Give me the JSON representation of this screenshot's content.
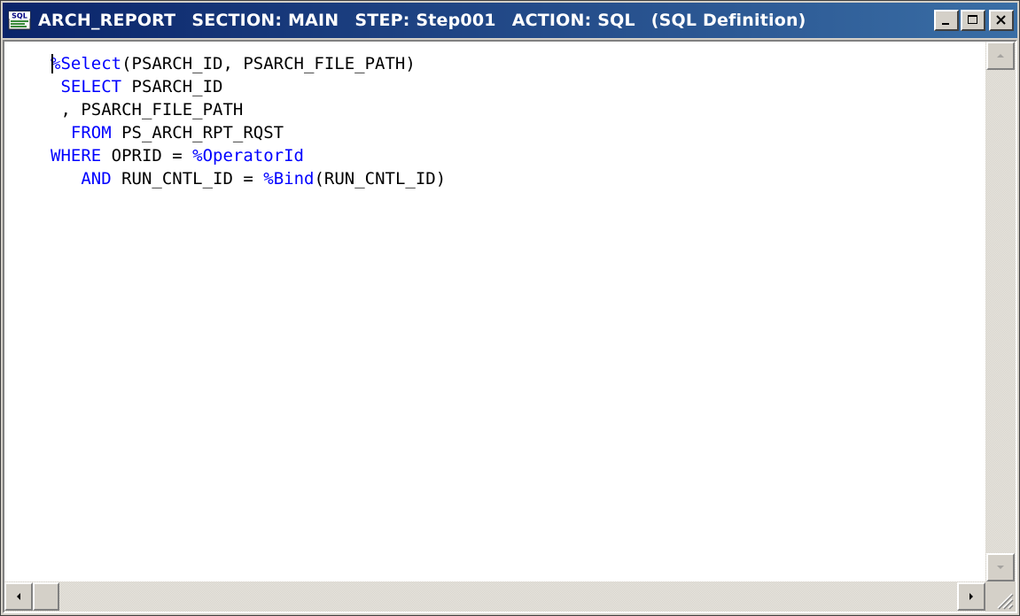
{
  "window": {
    "title_parts": [
      "ARCH_REPORT",
      "SECTION: MAIN",
      "STEP: Step001",
      "ACTION: SQL",
      "(SQL Definition)"
    ],
    "app_icon_label": "SQL",
    "buttons": {
      "minimize": "minimize-icon",
      "maximize": "maximize-icon",
      "close": "close-icon"
    }
  },
  "editor": {
    "lines": [
      {
        "indent": "",
        "tokens": [
          {
            "t": "%Select",
            "kw": true
          },
          {
            "t": "(PSARCH_ID, PSARCH_FILE_PATH)",
            "kw": false
          }
        ]
      },
      {
        "indent": " ",
        "tokens": [
          {
            "t": "SELECT",
            "kw": true
          },
          {
            "t": " PSARCH_ID",
            "kw": false
          }
        ]
      },
      {
        "indent": " ",
        "tokens": [
          {
            "t": ", PSARCH_FILE_PATH",
            "kw": false
          }
        ]
      },
      {
        "indent": "  ",
        "tokens": [
          {
            "t": "FROM",
            "kw": true
          },
          {
            "t": " PS_ARCH_RPT_RQST",
            "kw": false
          }
        ]
      },
      {
        "indent": "",
        "tokens": [
          {
            "t": "WHERE",
            "kw": true
          },
          {
            "t": " OPRID = ",
            "kw": false
          },
          {
            "t": "%OperatorId",
            "kw": true
          }
        ]
      },
      {
        "indent": "   ",
        "tokens": [
          {
            "t": "AND",
            "kw": true
          },
          {
            "t": " RUN_CNTL_ID = ",
            "kw": false
          },
          {
            "t": "%Bind",
            "kw": true
          },
          {
            "t": "(RUN_CNTL_ID)",
            "kw": false
          }
        ]
      }
    ]
  },
  "colors": {
    "keyword": "#0000ff",
    "text": "#000000",
    "title_bar": "#0a246a"
  }
}
